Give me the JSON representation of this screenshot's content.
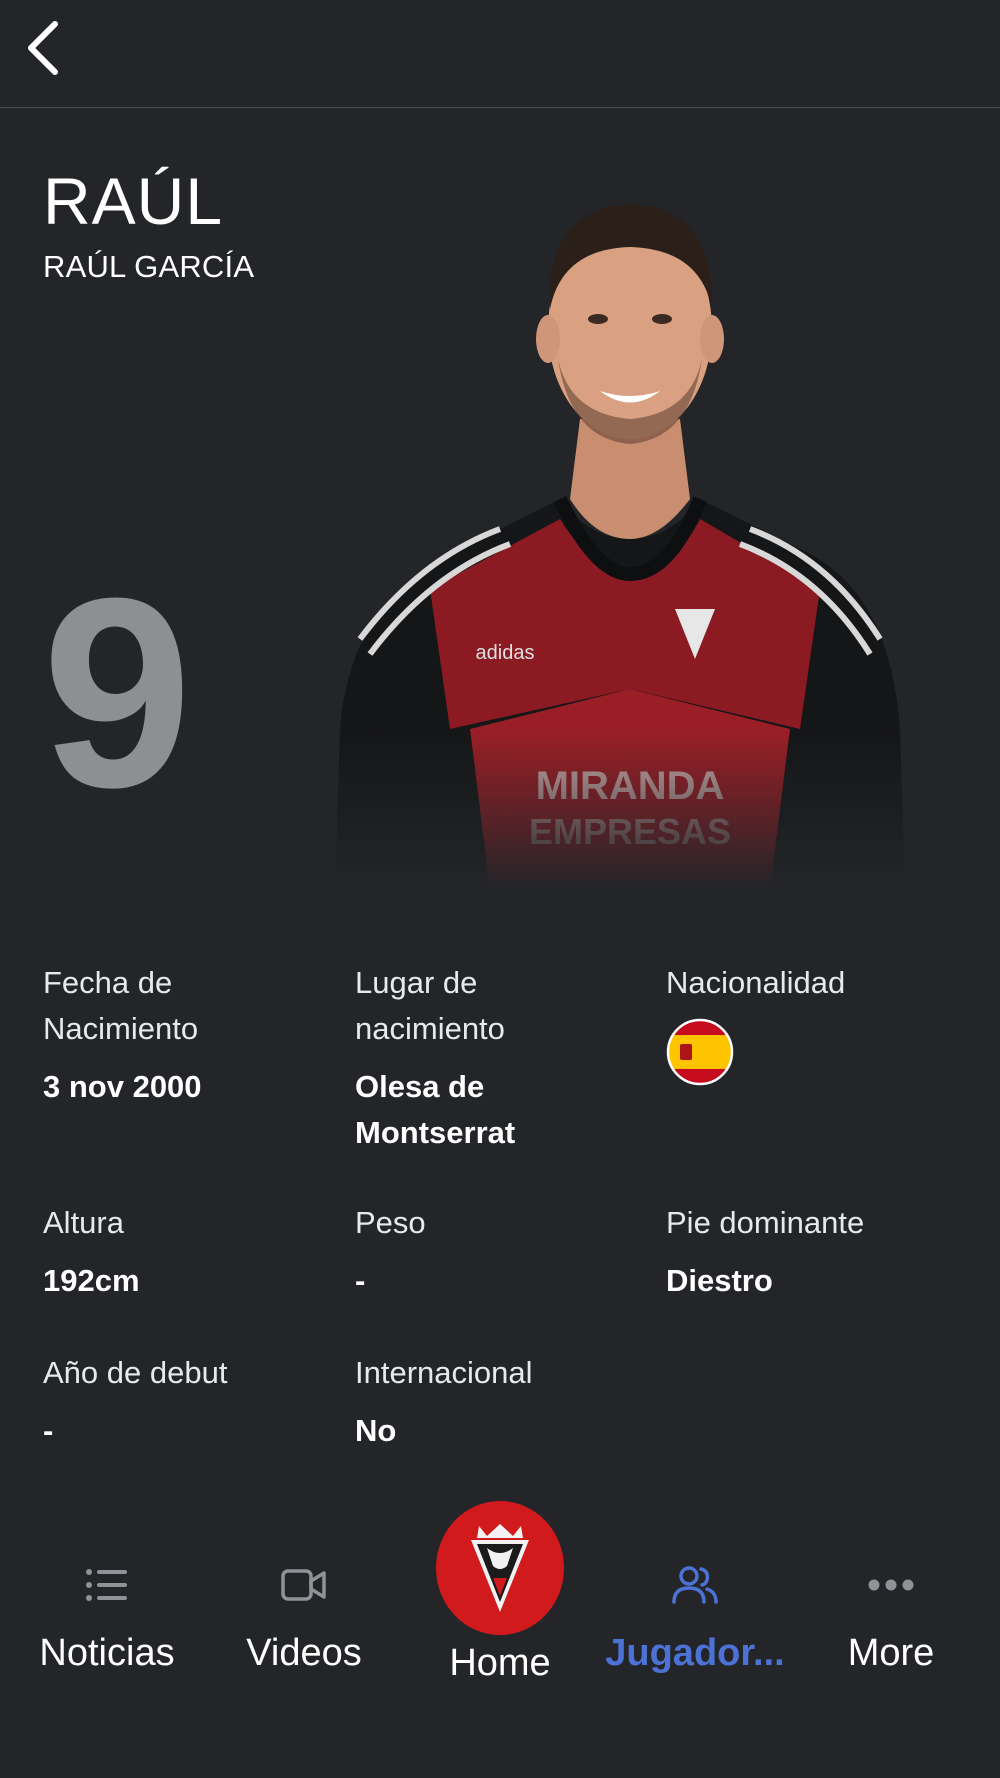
{
  "player": {
    "first_name": "RAÚL",
    "full_name": "RAÚL GARCÍA",
    "number": "9"
  },
  "details": {
    "birth_date": {
      "label": "Fecha de Nacimiento",
      "value": "3 nov 2000"
    },
    "birth_place": {
      "label": "Lugar de nacimiento",
      "value": "Olesa de Montserrat"
    },
    "nationality": {
      "label": "Nacionalidad",
      "flag_icon": "spain-flag-icon"
    },
    "height": {
      "label": "Altura",
      "value": "192cm"
    },
    "weight": {
      "label": "Peso",
      "value": "-"
    },
    "dominant_foot": {
      "label": "Pie dominante",
      "value": "Diestro"
    },
    "debut_year": {
      "label": "Año de debut",
      "value": "-"
    },
    "international": {
      "label": "Internacional",
      "value": "No"
    }
  },
  "nav": {
    "items": [
      {
        "label": "Noticias",
        "icon": "list-icon"
      },
      {
        "label": "Videos",
        "icon": "video-camera-icon"
      },
      {
        "label": "Home",
        "icon": "club-crest-icon"
      },
      {
        "label": "Jugador...",
        "icon": "users-icon",
        "active": true
      },
      {
        "label": "More",
        "icon": "more-dots-icon"
      }
    ]
  },
  "colors": {
    "background": "#232528",
    "accent_active": "#4d72d6",
    "home_button": "#d11a1c",
    "number": "#8d9093"
  }
}
